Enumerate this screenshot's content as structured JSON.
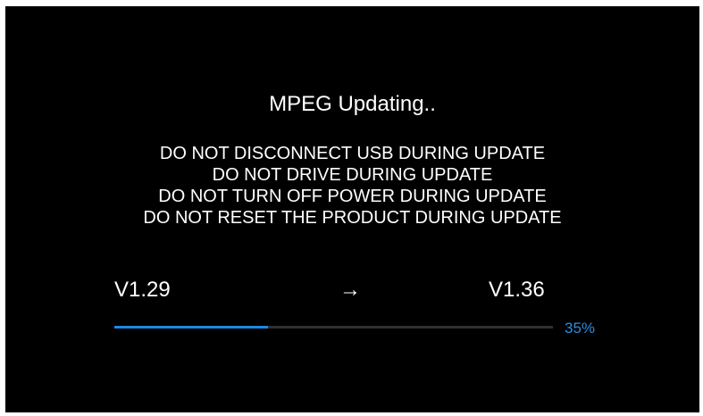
{
  "screen": {
    "title": "MPEG Updating..",
    "warnings": [
      "DO NOT DISCONNECT USB DURING UPDATE",
      "DO NOT DRIVE DURING UPDATE",
      "DO NOT TURN OFF POWER DURING UPDATE",
      "DO NOT RESET THE PRODUCT DURING UPDATE"
    ],
    "version_from": "V1.29",
    "arrow": "→",
    "version_to": "V1.36",
    "progress": {
      "value_percent": 35,
      "label": "35%"
    }
  },
  "colors": {
    "background": "#000000",
    "text": "#ffffff",
    "accent": "#1f88e0",
    "track": "#303030"
  }
}
